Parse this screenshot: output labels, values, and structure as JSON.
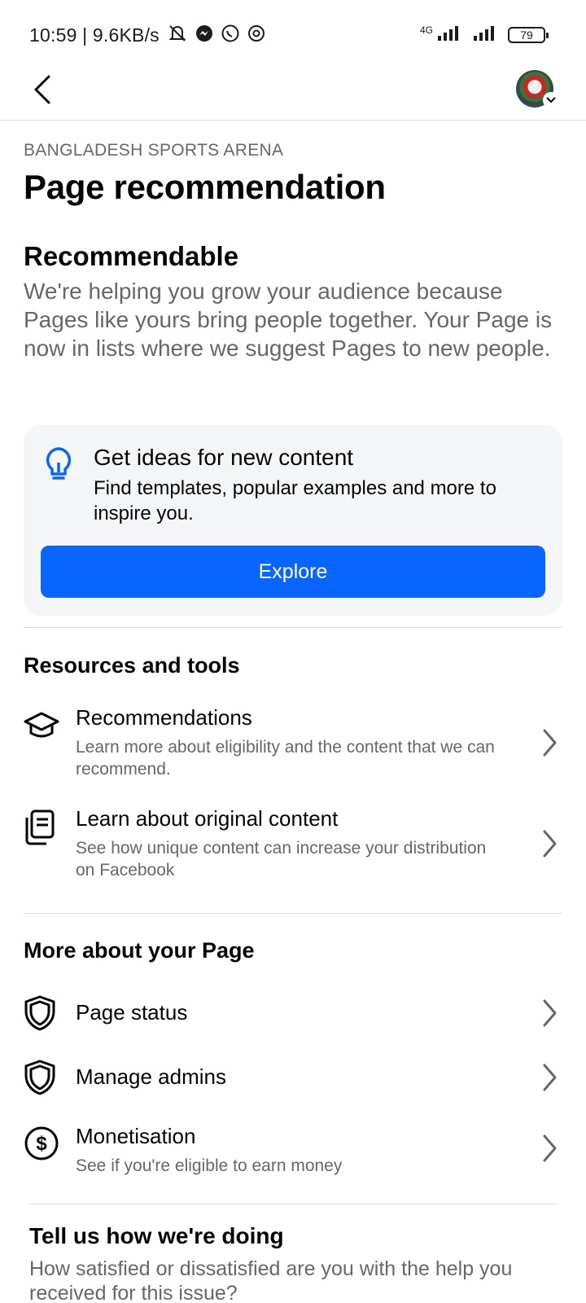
{
  "status_bar": {
    "time_speed": "10:59 | 9.6KB/s",
    "network": "4G",
    "battery": "79"
  },
  "header": {
    "page_name": "BANGLADESH SPORTS ARENA",
    "title": "Page recommendation"
  },
  "recommendable": {
    "title": "Recommendable",
    "description": "We're helping you grow your audience because Pages like yours bring people together. Your Page is now in lists where we suggest Pages to new people."
  },
  "ideas_card": {
    "icon": "lightbulb-icon",
    "title": "Get ideas for new content",
    "description": "Find templates, popular examples and more to inspire you.",
    "button_label": "Explore",
    "accent": "#0866ff"
  },
  "resources": {
    "title": "Resources and tools",
    "items": [
      {
        "icon": "graduation-cap-icon",
        "label": "Recommendations",
        "sub": "Learn more about eligibility and the content that we can recommend."
      },
      {
        "icon": "copy-document-icon",
        "label": "Learn about original content",
        "sub": "See how unique content can increase your distribution on Facebook"
      }
    ]
  },
  "more_about": {
    "title": "More about your Page",
    "items": [
      {
        "icon": "shield-icon",
        "label": "Page status",
        "sub": ""
      },
      {
        "icon": "shield-icon",
        "label": "Manage admins",
        "sub": ""
      },
      {
        "icon": "dollar-circle-icon",
        "label": "Monetisation",
        "sub": "See if you're eligible to earn money"
      }
    ]
  },
  "feedback": {
    "title": "Tell us how we're doing",
    "description": "How satisfied or dissatisfied are you with the help you received for this issue?"
  }
}
